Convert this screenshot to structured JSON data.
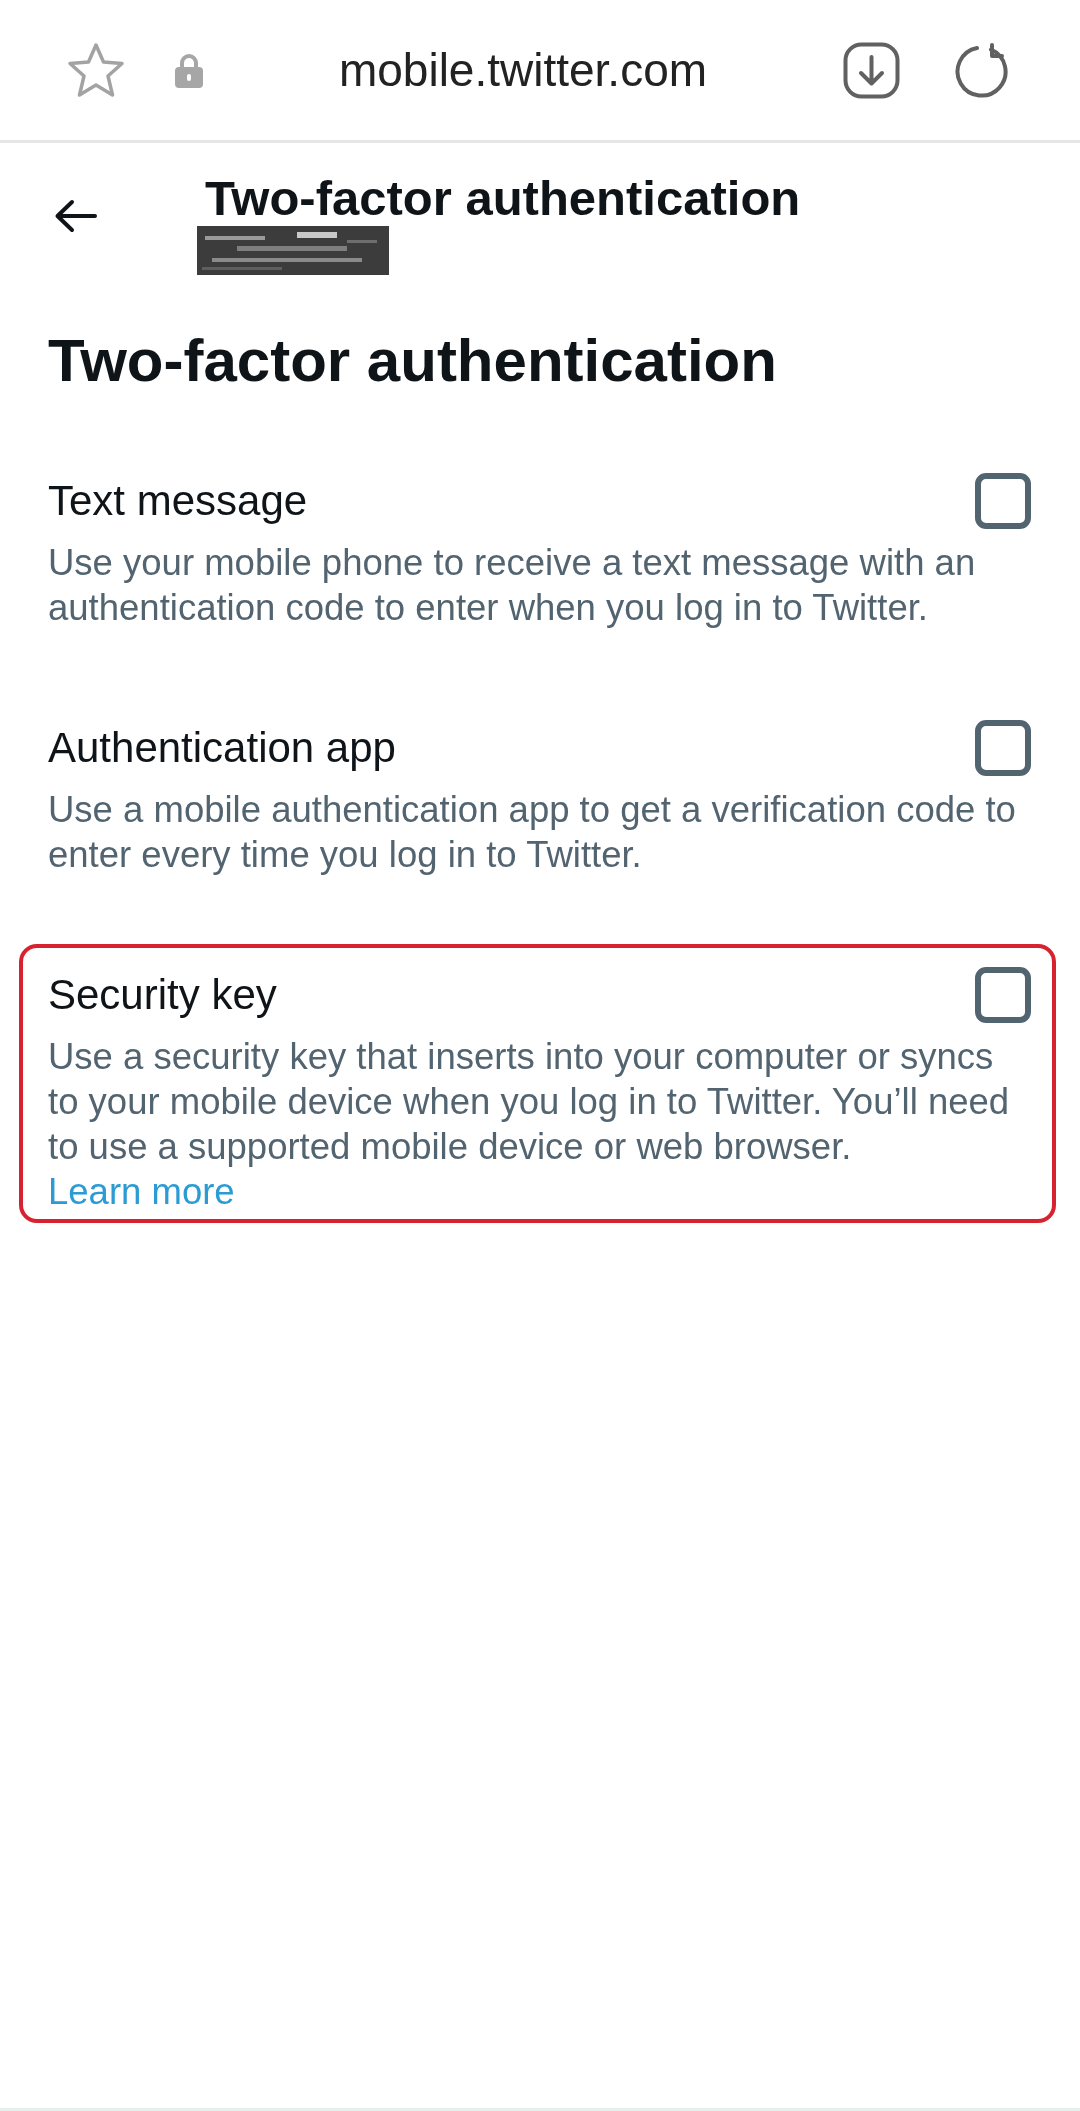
{
  "browser_bar": {
    "url": "mobile.twitter.com"
  },
  "header": {
    "title": "Two-factor authentication"
  },
  "heading": "Two-factor authentication",
  "options": [
    {
      "label": "Text message",
      "description": "Use your mobile phone to receive a text message with an authentication code to enter when you log in to Twitter.",
      "checked": false,
      "highlighted": false
    },
    {
      "label": "Authentication app",
      "description": "Use a mobile authentication app to get a verification code to enter every time you log in to Twitter.",
      "checked": false,
      "highlighted": false
    },
    {
      "label": "Security key",
      "description": "Use a security key that inserts into your computer or syncs to your mobile device when you log in to Twitter. You’ll need to use a supported mobile device or web browser.",
      "link": "Learn more",
      "checked": false,
      "highlighted": true
    }
  ]
}
